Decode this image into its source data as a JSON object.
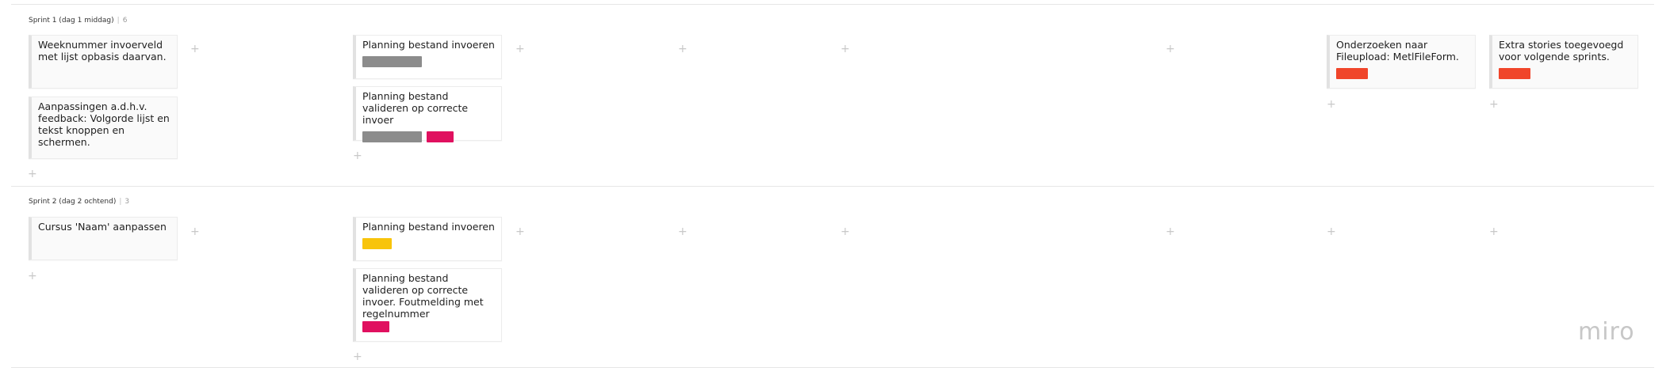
{
  "brand": {
    "logo_text": "miro"
  },
  "colors": {
    "gray_tag": "#8c8c8c",
    "pink_tag": "#e0105f",
    "orange_tag": "#f0452a",
    "yellow_tag": "#f8c40b"
  },
  "add_symbol": "+",
  "swimlanes": [
    {
      "label": "Sprint 1 (dag 1 middag)",
      "separator": "|",
      "count": "6",
      "cards": [
        {
          "text": "Weeknummer invoerveld met lijst opbasis daarvan.",
          "tags": []
        },
        {
          "text": "Aanpassingen a.d.h.v. feedback: Volgorde lijst en tekst knoppen en schermen.",
          "tags": []
        },
        {
          "text": "Planning bestand invoeren",
          "tags": [
            "gray"
          ]
        },
        {
          "text": "Planning bestand valideren op correcte invoer",
          "tags": [
            "gray",
            "pink"
          ]
        },
        {
          "text": "Onderzoeken naar Fileupload: MetlFileForm.",
          "tags": [
            "orange"
          ]
        },
        {
          "text": "Extra stories toegevoegd voor volgende sprints.",
          "tags": [
            "orange"
          ]
        }
      ]
    },
    {
      "label": "Sprint 2 (dag 2 ochtend)",
      "separator": "|",
      "count": "3",
      "cards": [
        {
          "text": "Cursus 'Naam' aanpassen",
          "tags": []
        },
        {
          "text": "Planning bestand invoeren",
          "tags": [
            "yellow"
          ]
        },
        {
          "text": "Planning bestand valideren op correcte invoer. Foutmelding met regelnummer",
          "tags": [
            "pink"
          ]
        }
      ]
    }
  ]
}
